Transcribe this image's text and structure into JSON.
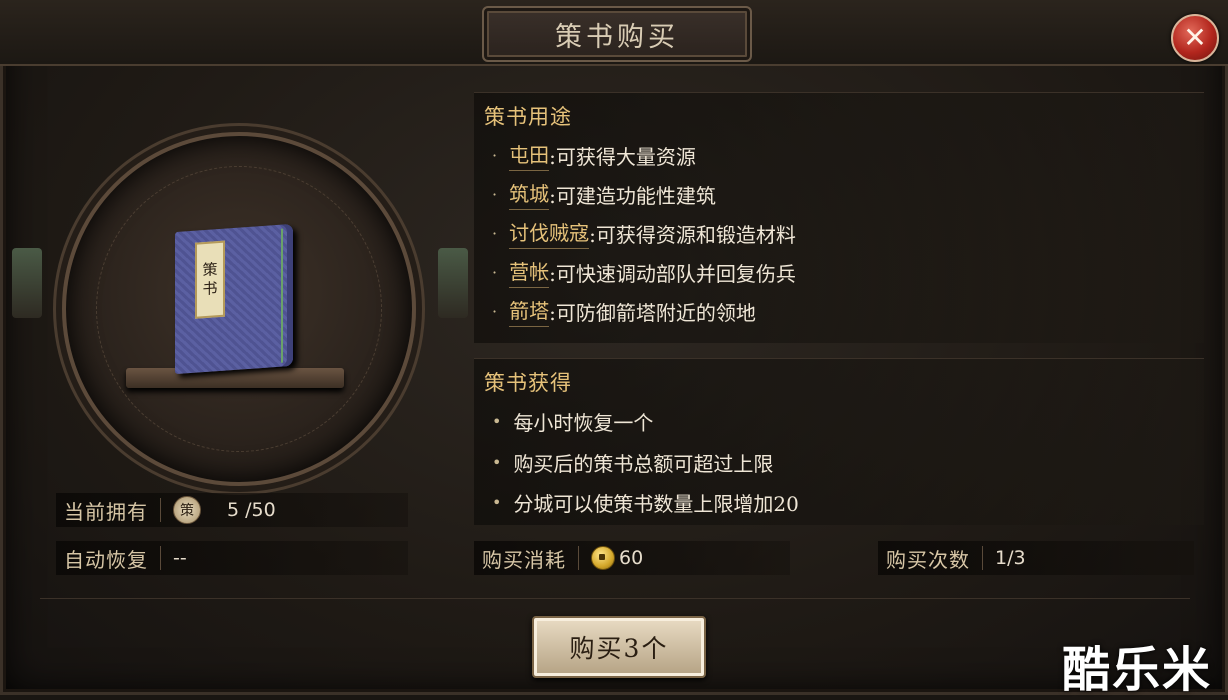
{
  "dialog": {
    "title": "策书购买",
    "close_symbol": "✕"
  },
  "book": {
    "label_line1": "策",
    "label_line2": "书"
  },
  "usage": {
    "title": "策书用途",
    "items": [
      {
        "keyword": "屯田",
        "desc": ":可获得大量资源"
      },
      {
        "keyword": "筑城",
        "desc": ":可建造功能性建筑"
      },
      {
        "keyword": "讨伐贼寇",
        "desc": ":可获得资源和锻造材料"
      },
      {
        "keyword": "营帐",
        "desc": ":可快速调动部队并回复伤兵"
      },
      {
        "keyword": "箭塔",
        "desc": ":可防御箭塔附近的领地"
      }
    ]
  },
  "obtain": {
    "title": "策书获得",
    "items": [
      "每小时恢复一个",
      "购买后的策书总额可超过上限",
      "分城可以使策书数量上限增加20"
    ]
  },
  "stats": {
    "owned_label": "当前拥有",
    "owned_badge": "策",
    "owned_value": "5 /50",
    "recover_label": "自动恢复",
    "recover_value": "--",
    "cost_label": "购买消耗",
    "cost_value": "60",
    "times_label": "购买次数",
    "times_value": "1/3"
  },
  "buy_button": {
    "label": "购买3个"
  },
  "watermark": "酷乐米",
  "colors": {
    "accent_gold": "#e6c27a",
    "close_red": "#b2261d",
    "book_blue": "#5b60a2"
  }
}
